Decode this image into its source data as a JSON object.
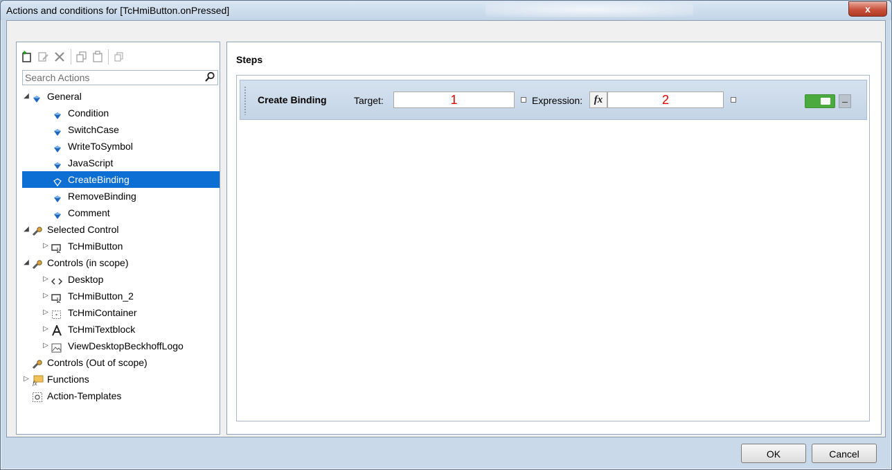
{
  "window": {
    "title": "Actions and conditions for [TcHmiButton.onPressed]",
    "close_glyph": "x"
  },
  "toolbar": {
    "icons": [
      "add-action-icon",
      "edit-icon",
      "delete-icon",
      "copy-icon",
      "paste-icon",
      "duplicate-icon"
    ]
  },
  "search": {
    "placeholder": "Search Actions"
  },
  "tree": [
    {
      "label": "General",
      "level": 0,
      "expanded": true,
      "icon": "gem-icon"
    },
    {
      "label": "Condition",
      "level": 1,
      "icon": "gem-icon"
    },
    {
      "label": "SwitchCase",
      "level": 1,
      "icon": "gem-icon"
    },
    {
      "label": "WriteToSymbol",
      "level": 1,
      "icon": "gem-icon"
    },
    {
      "label": "JavaScript",
      "level": 1,
      "icon": "gem-icon"
    },
    {
      "label": "CreateBinding",
      "level": 1,
      "icon": "gem-icon",
      "selected": true
    },
    {
      "label": "RemoveBinding",
      "level": 1,
      "icon": "gem-icon"
    },
    {
      "label": "Comment",
      "level": 1,
      "icon": "gem-icon"
    },
    {
      "label": "Selected Control",
      "level": 0,
      "expanded": true,
      "icon": "wrench-icon"
    },
    {
      "label": "TcHmiButton",
      "level": 1,
      "collapsed": true,
      "icon": "button-control-icon"
    },
    {
      "label": "Controls (in scope)",
      "level": 0,
      "expanded": true,
      "icon": "wrench-icon"
    },
    {
      "label": "Desktop",
      "level": 1,
      "collapsed": true,
      "icon": "code-icon"
    },
    {
      "label": "TcHmiButton_2",
      "level": 1,
      "collapsed": true,
      "icon": "button-control-icon"
    },
    {
      "label": "TcHmiContainer",
      "level": 1,
      "collapsed": true,
      "icon": "container-icon"
    },
    {
      "label": "TcHmiTextblock",
      "level": 1,
      "collapsed": true,
      "icon": "textblock-icon"
    },
    {
      "label": "ViewDesktopBeckhoffLogo",
      "level": 1,
      "collapsed": true,
      "icon": "image-icon"
    },
    {
      "label": "Controls (Out of scope)",
      "level": 0,
      "icon": "wrench-icon"
    },
    {
      "label": "Functions",
      "level": 0,
      "collapsed": true,
      "icon": "functions-icon"
    },
    {
      "label": "Action-Templates",
      "level": 0,
      "icon": "template-icon"
    }
  ],
  "steps": {
    "heading": "Steps",
    "items": [
      {
        "name": "Create Binding",
        "target_label": "Target:",
        "target_value": "1",
        "expression_label": "Expression:",
        "fx_label": "fx",
        "expression_value": "2",
        "enabled": true
      }
    ]
  },
  "footer": {
    "ok_label": "OK",
    "cancel_label": "Cancel"
  },
  "colors": {
    "selection": "#0d6ed3",
    "annotation_red": "#e00000",
    "toggle_green": "#4aaa3e"
  }
}
